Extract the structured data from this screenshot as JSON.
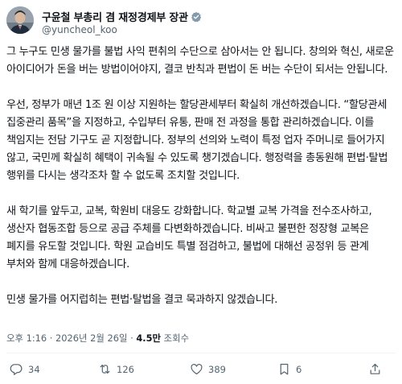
{
  "author": {
    "display_name": "구윤철 부총리 겸 재정경제부 장관",
    "handle": "@yuncheol_koo",
    "verified_color": "#829aab"
  },
  "paragraphs": [
    "그 누구도 민생 물가를 불법 사익 편취의 수단으로 삼아서는 안 됩니다. 창의와 혁신, 새로운 아이디어가 돈을 버는 방법이어야지, 결코 반칙과 편법이 돈 버는 수단이 되서는 안됩니다.",
    "우선, 정부가 매년 1조 원 이상 지원하는 할당관세부터 확실히 개선하겠습니다. “할당관세 집중관리 품목”을 지정하고, 수입부터 유통, 판매 전 과정을 통합 관리하겠습니다. 이를 책임지는 전담 기구도 곧 지정합니다. 정부의 선의와 노력이 특정 업자 주머니로 들어가지 않고, 국민께 확실히 혜택이 귀속될 수 있도록 챙기겠습니다. 행정력을 총동원해 편법·탈법 행위를 다시는 생각조차 할 수 없도록 조치할 것입니다.",
    "새 학기를 앞두고, 교복, 학원비 대응도 강화합니다. 학교별 교복 가격을 전수조사하고, 생산자 협동조합 등으로 공급 주체를 다변화하겠습니다. 비싸고 불편한 정장형 교복은 폐지를 유도할 것입니다. 학원 교습비도 특별 점검하고, 불법에 대해선 공정위 등 관계 부처와 함께 대응하겠습니다.",
    "민생 물가를 어지럽히는 편법·탈법을 결코 묵과하지 않겠습니다."
  ],
  "meta": {
    "time": "오후 1:16",
    "separator": " · ",
    "date": "2026년 2월 26일",
    "views_count": "4.5만",
    "views_label": " 조회수"
  },
  "actions": {
    "replies": "34",
    "reposts": "126",
    "likes": "389",
    "bookmarks": "6"
  },
  "colors": {
    "text": "#0f1419",
    "secondary": "#536471",
    "divider": "#eff3f4"
  }
}
